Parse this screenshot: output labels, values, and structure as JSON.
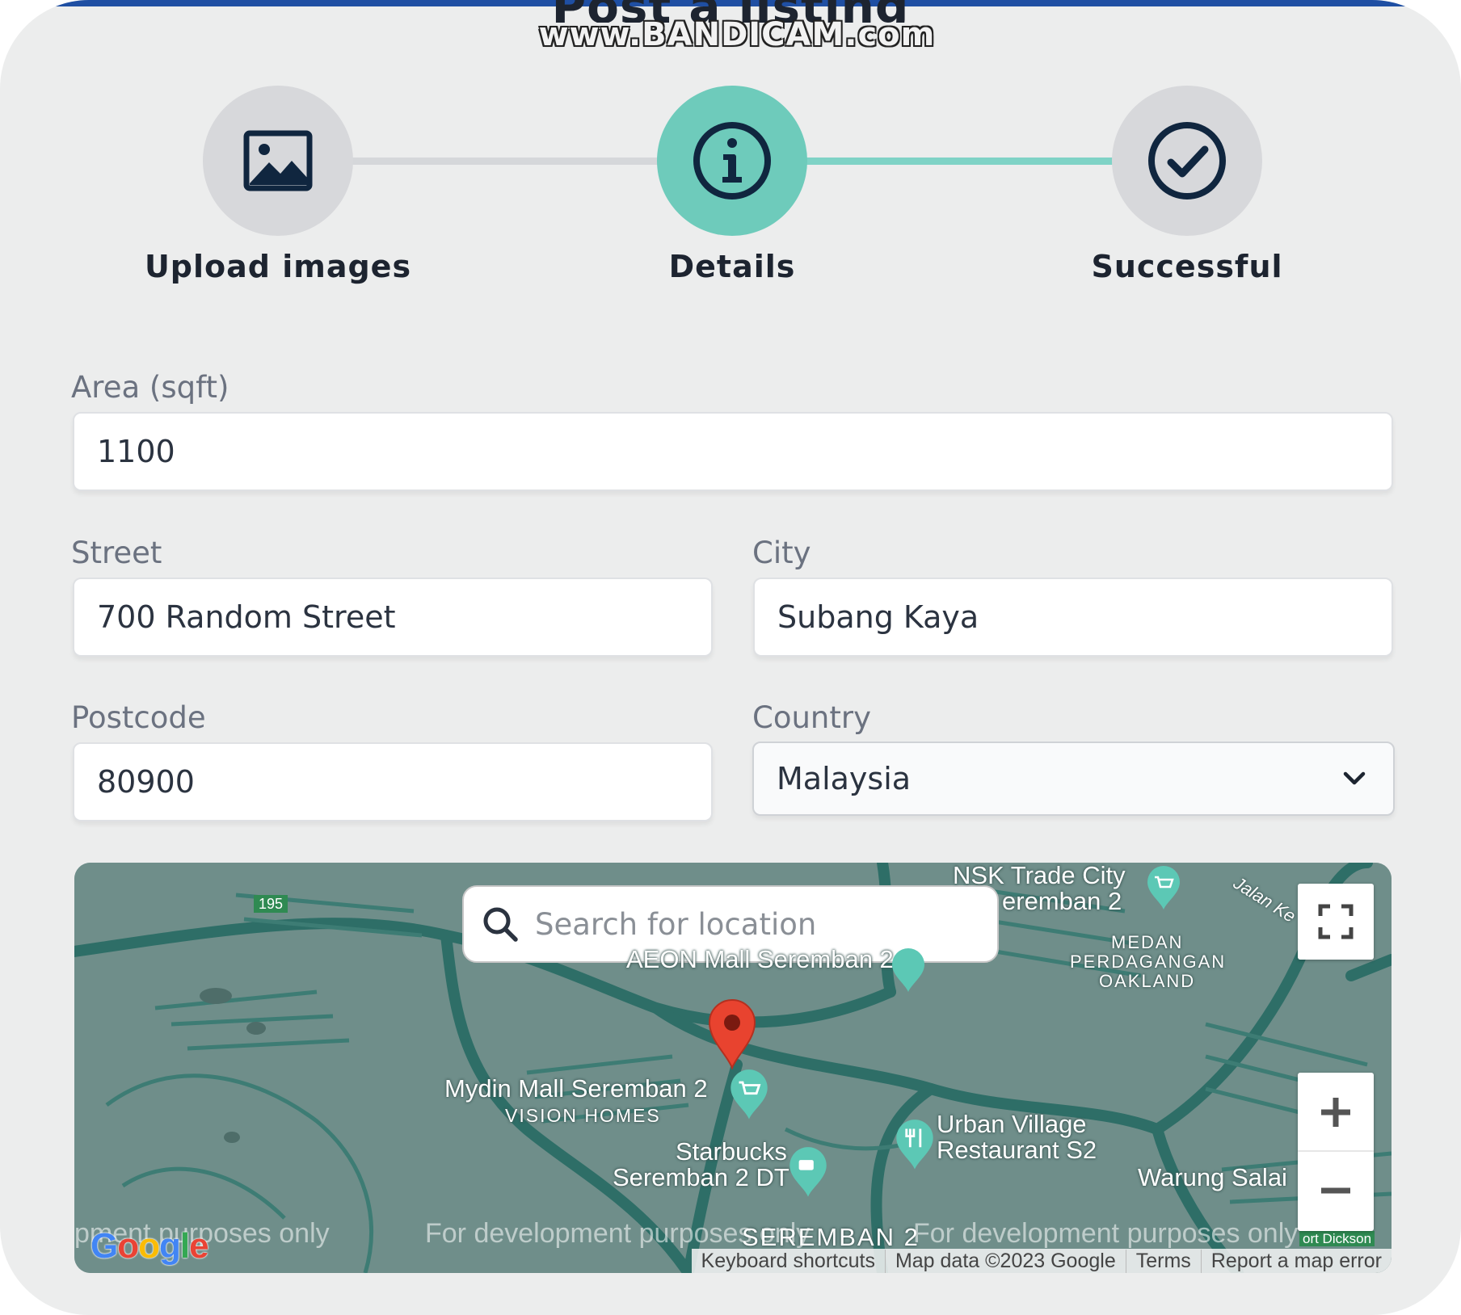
{
  "page": {
    "heading": "Post a listing",
    "watermark": "www.BANDICAM.com"
  },
  "stepper": {
    "steps": [
      {
        "label": "Upload images",
        "icon": "image-icon",
        "state": "complete"
      },
      {
        "label": "Details",
        "icon": "info-icon",
        "state": "active"
      },
      {
        "label": "Successful",
        "icon": "check-circle-icon",
        "state": "pending"
      }
    ],
    "colors": {
      "active": "#6ecbbb",
      "inactive": "#d7d8db",
      "icon": "#10263f"
    }
  },
  "form": {
    "area": {
      "label": "Area (sqft)",
      "value": "1100"
    },
    "street": {
      "label": "Street",
      "value": "700 Random Street"
    },
    "city": {
      "label": "City",
      "value": "Subang Kaya"
    },
    "postcode": {
      "label": "Postcode",
      "value": "80900"
    },
    "country": {
      "label": "Country",
      "value": "Malaysia"
    }
  },
  "map": {
    "search_placeholder": "Search for location",
    "places": {
      "nsk": "NSK Trade City",
      "nsk2": "eremban 2",
      "jalan": "Jalan Ke",
      "medan1": "MEDAN",
      "medan2": "PERDAGANGAN",
      "medan3": "OAKLAND",
      "aeon": "AEON Mall Seremban 2",
      "mydin": "Mydin Mall Seremban 2",
      "vision": "VISION HOMES",
      "urban1": "Urban Village",
      "urban2": "Restaurant S2",
      "starbucks1": "Starbucks",
      "starbucks2": "Seremban 2 DT",
      "warung": "Warung Salai",
      "seremban": "SEREMBAN 2",
      "route": "195",
      "port": "ort Dickson"
    },
    "dev_notes": [
      "pment purposes only",
      "For development purposes only",
      "For development purposes only"
    ],
    "google": "Google",
    "attribution": {
      "shortcuts": "Keyboard shortcuts",
      "data": "Map data ©2023 Google",
      "terms": "Terms",
      "report": "Report a map error"
    },
    "colors": {
      "base": "#6f8e8a",
      "road": "#2e6e67",
      "pin": "#e8432f",
      "poi": "#5cc8b5"
    }
  }
}
